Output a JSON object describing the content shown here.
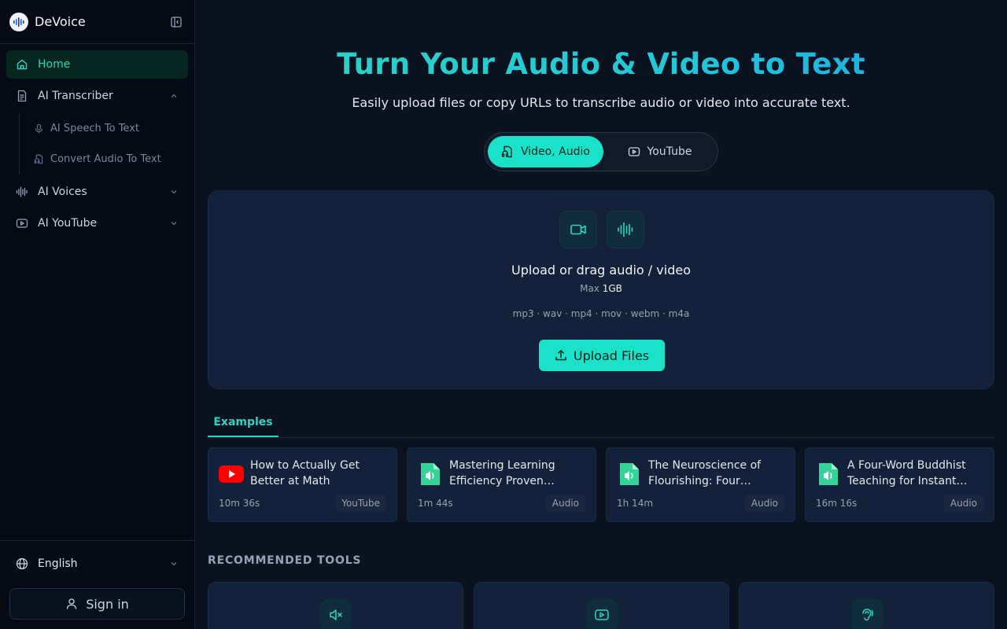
{
  "brand": {
    "name": "DeVoice"
  },
  "sidebar": {
    "items": [
      {
        "label": "Home",
        "icon": "home-icon",
        "active": true
      },
      {
        "label": "AI Transcriber",
        "icon": "document-icon",
        "expanded": true,
        "children": [
          {
            "label": "AI Speech To Text",
            "icon": "microphone-icon"
          },
          {
            "label": "Convert Audio To Text",
            "icon": "audio-file-icon"
          }
        ]
      },
      {
        "label": "AI Voices",
        "icon": "waveform-icon",
        "expanded": false
      },
      {
        "label": "AI YouTube",
        "icon": "youtube-icon",
        "expanded": false
      }
    ],
    "language": "English",
    "sign_in": "Sign in"
  },
  "hero": {
    "title": "Turn Your Audio & Video to Text",
    "subtitle": "Easily upload files or copy URLs to transcribe audio or video into accurate text."
  },
  "tabs": [
    {
      "label": "Video, Audio",
      "active": true
    },
    {
      "label": "YouTube",
      "active": false
    }
  ],
  "upload": {
    "title": "Upload or drag audio / video",
    "max_label": "Max",
    "max_value": "1GB",
    "formats": "mp3 · wav · mp4 · mov · webm · m4a",
    "button": "Upload Files"
  },
  "examples": {
    "tab_label": "Examples",
    "items": [
      {
        "title": "How to Actually Get Better at Math",
        "duration": "10m 36s",
        "type": "YouTube",
        "icon": "youtube-logo-icon"
      },
      {
        "title": "Mastering Learning Efficiency Proven…",
        "duration": "1m 44s",
        "type": "Audio",
        "icon": "audio-file-icon"
      },
      {
        "title": "The Neuroscience of Flourishing: Four…",
        "duration": "1h 14m",
        "type": "Audio",
        "icon": "audio-file-icon"
      },
      {
        "title": "A Four-Word Buddhist Teaching for Instant…",
        "duration": "16m 16s",
        "type": "Audio",
        "icon": "audio-file-icon"
      }
    ]
  },
  "recommended": {
    "title": "RECOMMENDED TOOLS",
    "items": [
      {
        "icon": "mute-icon"
      },
      {
        "icon": "youtube-icon"
      },
      {
        "icon": "ear-icon"
      }
    ]
  },
  "colors": {
    "accent": "#19e2c8",
    "background": "#0b1220",
    "sidebar": "#050a14",
    "card": "#13213a",
    "youtube": "#ff0000",
    "audio_file": "#34d399"
  }
}
